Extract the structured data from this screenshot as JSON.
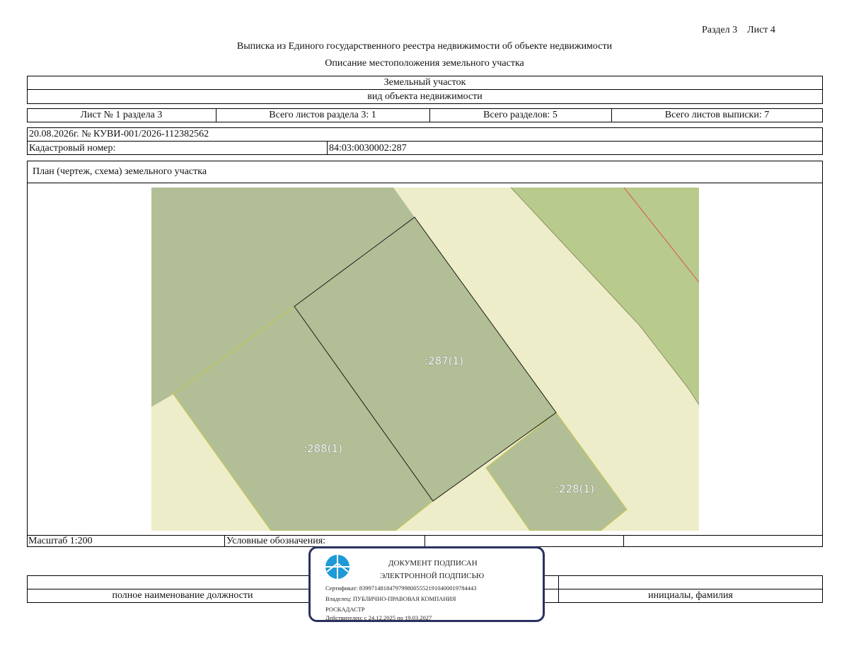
{
  "header": {
    "section_sheet": "Раздел 3    Лист 4",
    "title": "Выписка из Единого государственного реестра недвижимости об объекте недвижимости",
    "subtitle": "Описание местоположения земельного участка"
  },
  "object": {
    "type_value": "Земельный участок",
    "type_caption": "вид объекта недвижимости"
  },
  "sheet_info": {
    "sheet_no": "Лист № 1 раздела 3",
    "total_section_sheets": "Всего листов раздела 3: 1",
    "total_sections": "Всего разделов: 5",
    "total_extract_sheets": "Всего листов выписки: 7"
  },
  "record": {
    "date_number": "20.08.2026г. № КУВИ-001/2026-112382562",
    "cadastral_label": "Кадастровый номер:",
    "cadastral_value": "84:03:0030002:287"
  },
  "plan": {
    "title": "План (чертеж, схема) земельного участка",
    "labels": {
      "parcel_287": ":287(1)",
      "parcel_288": ":288(1)",
      "parcel_228": ":228(1)"
    },
    "colors": {
      "parcel_fill": "#b2bf96",
      "road_fill": "#eeedc9",
      "greenzone_fill": "#b8cb8c",
      "boundary_line": "#1a1a1a",
      "red_line": "#e05050"
    }
  },
  "footer": {
    "scale": "Масштаб 1:200",
    "legend": "Условные обозначения:",
    "position_caption": "полное наименование должности",
    "initials_caption": "инициалы, фамилия"
  },
  "stamp": {
    "line1": "ДОКУМЕНТ ПОДПИСАН",
    "line2": "ЭЛЕКТРОННОЙ ПОДПИСЬЮ",
    "certificate": "Сертификат: 839971481847979980055521910400019784443",
    "owner": "Владелец: ПУБЛИЧНО-ПРАВОВАЯ КОМПАНИЯ",
    "owner2": "РОСКАДАСТР",
    "validity": "Действителен: с 24.12.2025 по 19.03.2027",
    "logo_icon": "emblem-icon",
    "border_color": "#2b3160"
  }
}
